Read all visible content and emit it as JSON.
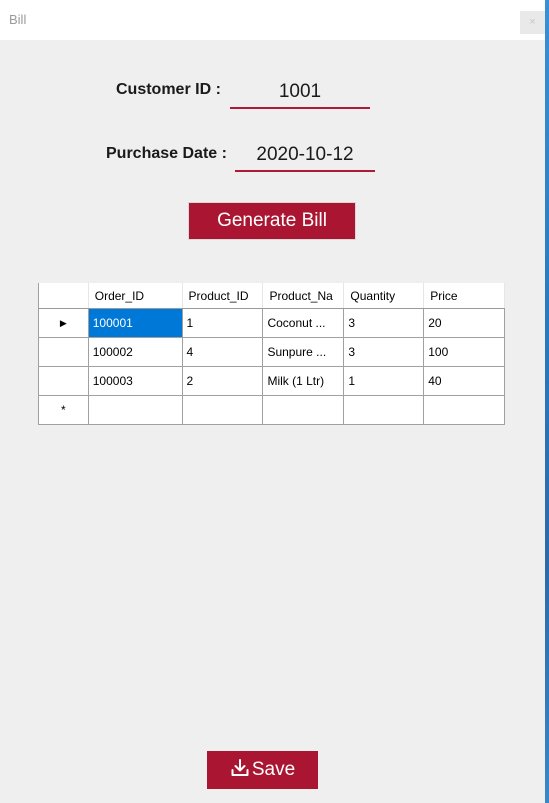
{
  "window": {
    "title": "Bill",
    "close_glyph": "×"
  },
  "form": {
    "customer_id_label": "Customer ID :",
    "customer_id_value": "1001",
    "purchase_date_label": "Purchase Date :",
    "purchase_date_value": "2020-10-12",
    "generate_button_label": "Generate Bill",
    "save_button_label": "Save",
    "save_icon": "download-icon"
  },
  "grid": {
    "columns": [
      "Order_ID",
      "Product_ID",
      "Product_Na",
      "Quantity",
      "Price"
    ],
    "rows": [
      [
        "100001",
        "1",
        "Coconut ...",
        "3",
        "20"
      ],
      [
        "100002",
        "4",
        "Sunpure ...",
        "3",
        "100"
      ],
      [
        "100003",
        "2",
        "Milk (1 Ltr)",
        "1",
        "40"
      ]
    ],
    "current_row_marker": "▶",
    "new_row_marker": "*"
  },
  "colors": {
    "accent": "#aa1632",
    "selection": "#0078d7",
    "background": "#efefef"
  }
}
